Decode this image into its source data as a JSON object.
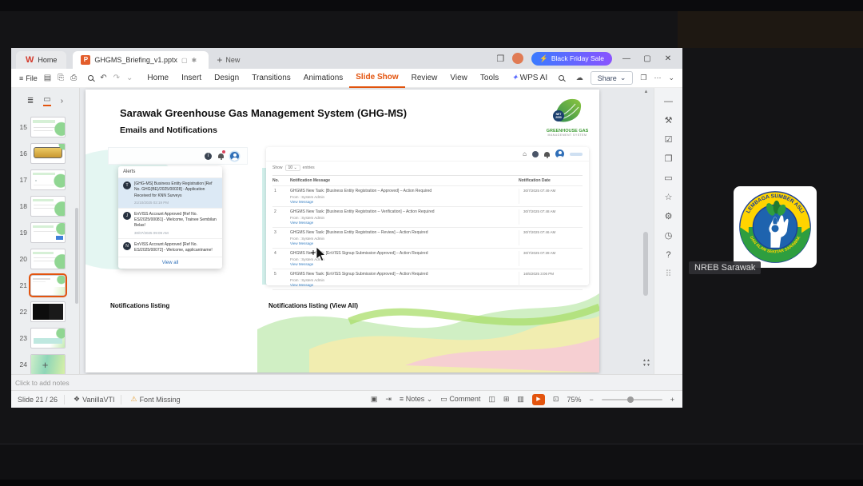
{
  "icons": {
    "wps_logo": "W",
    "ppt": "P",
    "tab_preview": "▢",
    "modified": "✱",
    "new_plus": "+",
    "board": "❐",
    "minimize": "—",
    "maximize": "▢",
    "close": "✕",
    "lightning": "⚡",
    "hamburger": "≡",
    "save": "▤",
    "export": "⎘",
    "print": "⎙",
    "undo": "↶",
    "redo": "↷",
    "caret": "⌄",
    "cloud": "☁",
    "sparkle": "✦",
    "dots": "⋯",
    "home": "⌂",
    "outline_view": "≣",
    "slides_view": "▭",
    "collapse": "›",
    "template": "❖",
    "warning": "⚠",
    "selection": "▣",
    "jump": "⇥",
    "notes": "≡",
    "comment": "▭",
    "view_normal": "◫",
    "view_sorter": "⊞",
    "view_read": "▥",
    "play": "▶",
    "fullscreen": "⊡",
    "minus": "−",
    "plus": "+",
    "scroll_up": "▲",
    "nav_prev": "▲▲",
    "nav_next": "▼▼"
  },
  "titlebar": {
    "home_tab": "Home",
    "doc_tab": "GHGMS_Briefing_v1.pptx",
    "new_label": "New",
    "promo": "Black Friday Sale"
  },
  "menubar": {
    "file": "File",
    "items": [
      "Home",
      "Insert",
      "Design",
      "Transitions",
      "Animations",
      "Slide Show",
      "Review",
      "View",
      "Tools",
      "WPS AI"
    ],
    "active": "Slide Show",
    "share": "Share"
  },
  "thumbnail_panel": {
    "selected": "21",
    "slides": [
      {
        "num": "15",
        "variant": "lines"
      },
      {
        "num": "16",
        "variant": "gold"
      },
      {
        "num": "17",
        "variant": "dots"
      },
      {
        "num": "18",
        "variant": "blob"
      },
      {
        "num": "19",
        "variant": "chip"
      },
      {
        "num": "20",
        "variant": "blob"
      },
      {
        "num": "21",
        "variant": "current"
      },
      {
        "num": "22",
        "variant": "dark"
      },
      {
        "num": "23",
        "variant": "tealbar"
      },
      {
        "num": "24",
        "variant": "wave"
      }
    ]
  },
  "rail": [
    {
      "name": "fit-width-icon",
      "glyph": "—",
      "dim": false
    },
    {
      "name": "tools-icon",
      "glyph": "⚒",
      "dim": false
    },
    {
      "name": "check-task-icon",
      "glyph": "☑",
      "dim": false
    },
    {
      "name": "layers-icon",
      "glyph": "❐",
      "dim": false
    },
    {
      "name": "comment-pane-icon",
      "glyph": "▭",
      "dim": false
    },
    {
      "name": "star-icon",
      "glyph": "☆",
      "dim": false
    },
    {
      "name": "settings-icon",
      "glyph": "⚙",
      "dim": false
    },
    {
      "name": "history-clock-icon",
      "glyph": "◷",
      "dim": false
    },
    {
      "name": "help-icon",
      "glyph": "?",
      "dim": false
    },
    {
      "name": "grid-apps-icon",
      "glyph": "⠿",
      "dim": true
    }
  ],
  "slide": {
    "title": "Sarawak Greenhouse Gas Management System (GHG-MS)",
    "subtitle": "Emails and Notifications",
    "logo_line1": "GREENHOUSE GAS",
    "logo_line2": "MANAGEMENT SYSTEM",
    "caption_left": "Notifications listing",
    "caption_right": "Notifications listing (View All)",
    "alerts_panel": {
      "header": "Alerts",
      "items": [
        {
          "avatar": "T",
          "text": "[GHG-MS] Business Entity Registration [Ref No. GHG(BE)/2025/00028] - Application Received for KNN Surveys",
          "date": "21/10/2025 02:19 PM",
          "highlight": true
        },
        {
          "avatar": "J",
          "text": "EnVISS Account Approved [Ref No. ES/2025/00081] - Welcome, Trainee Sembilan Belas!",
          "date": "30/07/2025 09:09 AM",
          "highlight": false
        },
        {
          "avatar": "N",
          "text": "EnVISS Account Approved [Ref No. ES/2025/00072] - Welcome, applicantname!",
          "date": "",
          "highlight": false
        }
      ],
      "view_all_label": "View all"
    },
    "table_panel": {
      "show_label": "Show",
      "show_value": "10",
      "entries_label": "entries",
      "columns": [
        "No.",
        "Notification Message",
        "Notification Date"
      ],
      "rows": [
        {
          "no": "1",
          "message": "GHGMS New Task: [Business Entity Registration – Approved] – Action Required",
          "from": "From : System Admin",
          "link": "View Message",
          "date": "30/7/2025 07:49 AM"
        },
        {
          "no": "2",
          "message": "GHGMS New Task: [Business Entity Registration – Verification] – Action Required",
          "from": "From : System Admin",
          "link": "View Message",
          "date": "30/7/2025 07:48 AM"
        },
        {
          "no": "3",
          "message": "GHGMS New Task: [Business Entity Registration – Review] – Action Required",
          "from": "From : System Admin",
          "link": "View Message",
          "date": "30/7/2025 07:46 AM"
        },
        {
          "no": "4",
          "message": "GHGMS New Task: [EnVISS Signup Submission Approved] – Action Required",
          "from": "From : System Admin",
          "link": "View Message",
          "date": "30/7/2025 07:39 AM"
        },
        {
          "no": "5",
          "message": "GHGMS New Task: [EnVISS Signup Submission Approved] – Action Required",
          "from": "From : System Admin",
          "link": "View Message",
          "date": "16/5/2025 3:06 PM"
        }
      ]
    }
  },
  "notes_placeholder": "Click to add notes",
  "statusbar": {
    "slide_label": "Slide 21 / 26",
    "template_label": "VanillaVTI",
    "font_warning": "Font Missing",
    "notes_label": "Notes",
    "comment_label": "Comment",
    "zoom_label": "75%"
  },
  "videocall": {
    "participant_label": "NREB Sarawak",
    "logo_top_text": "LEMBAGA SUMBER ASLI",
    "logo_bottom_text": "DAN ALAM SEKITAR SARAWAK"
  }
}
